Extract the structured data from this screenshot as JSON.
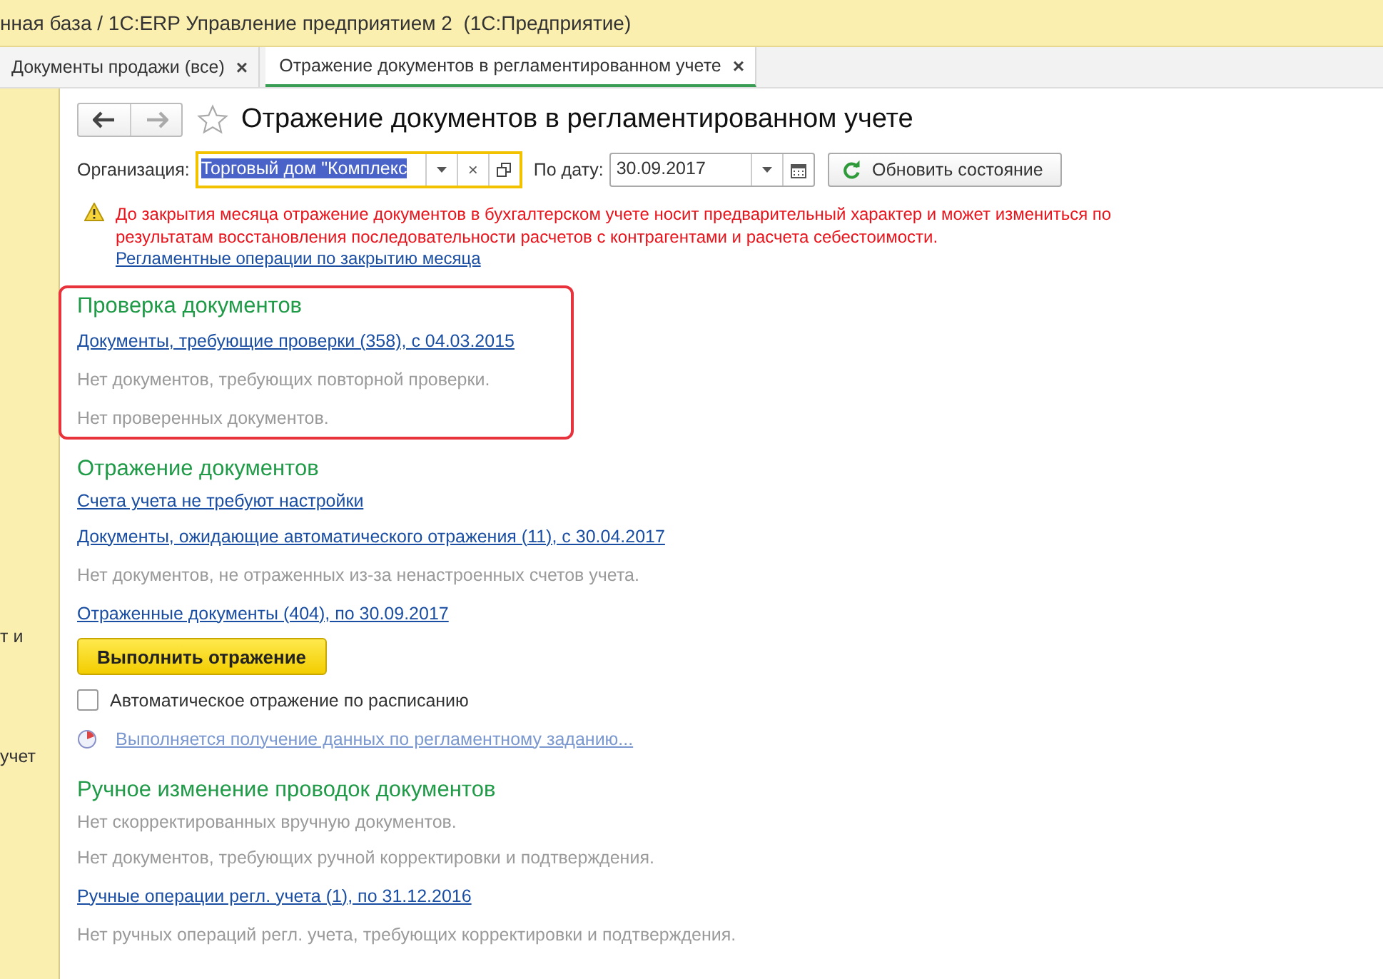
{
  "window": {
    "title": "нная база / 1С:ERP Управление предприятием 2  (1С:Предприятие)"
  },
  "tabs": [
    {
      "label": "Документы продажи (все)",
      "close": "×",
      "selected": false
    },
    {
      "label": "Отражение документов в регламентированном учете",
      "close": "×",
      "selected": true
    }
  ],
  "sidebar": {
    "items": [
      "т и",
      "учет"
    ]
  },
  "form": {
    "title": "Отражение документов в регламентированном учете",
    "favorite": false,
    "nav": {
      "back_disabled": false,
      "forward_disabled": true
    },
    "organization": {
      "label": "Организация:",
      "value": "Торговый дом \"Комплекс",
      "selected": true,
      "clear": "×"
    },
    "date": {
      "label": "По дату:",
      "value": "30.09.2017"
    },
    "refresh_button": "Обновить состояние",
    "warning": {
      "text": "До закрытия месяца отражение документов в бухгалтерском учете носит предварительный характер и может измениться по результатам восстановления последовательности расчетов с контрагентами и расчета себестоимости.",
      "link": "Регламентные операции по закрытию месяца"
    },
    "sections": [
      {
        "title": "Проверка документов",
        "highlighted": true,
        "items": [
          {
            "kind": "link",
            "text": "Документы, требующие проверки (358), с 04.03.2015"
          },
          {
            "kind": "note",
            "text": "Нет документов, требующих повторной проверки."
          },
          {
            "kind": "note",
            "text": "Нет проверенных документов."
          }
        ]
      },
      {
        "title": "Отражение документов",
        "highlighted": false,
        "items": [
          {
            "kind": "link",
            "text": "Счета учета не требуют настройки"
          },
          {
            "kind": "link",
            "text": "Документы, ожидающие автоматического отражения (11), с 30.04.2017"
          },
          {
            "kind": "note",
            "text": "Нет документов, не отраженных из-за ненастроенных счетов учета."
          },
          {
            "kind": "link",
            "text": "Отраженные документы (404), по 30.09.2017"
          },
          {
            "kind": "button",
            "text": "Выполнить отражение"
          },
          {
            "kind": "checkbox",
            "text": "Автоматическое отражение по расписанию",
            "checked": false
          },
          {
            "kind": "progress",
            "text": "Выполняется получение данных по регламентному заданию..."
          }
        ]
      },
      {
        "title": "Ручное изменение проводок документов",
        "highlighted": false,
        "items": [
          {
            "kind": "note",
            "text": "Нет скорректированных вручную документов."
          },
          {
            "kind": "note",
            "text": "Нет документов, требующих ручной корректировки и подтверждения."
          },
          {
            "kind": "link",
            "text": "Ручные операции регл. учета (1), по 31.12.2016"
          },
          {
            "kind": "note",
            "text": "Нет ручных операций регл. учета, требующих корректировки и подтверждения."
          }
        ]
      }
    ]
  }
}
